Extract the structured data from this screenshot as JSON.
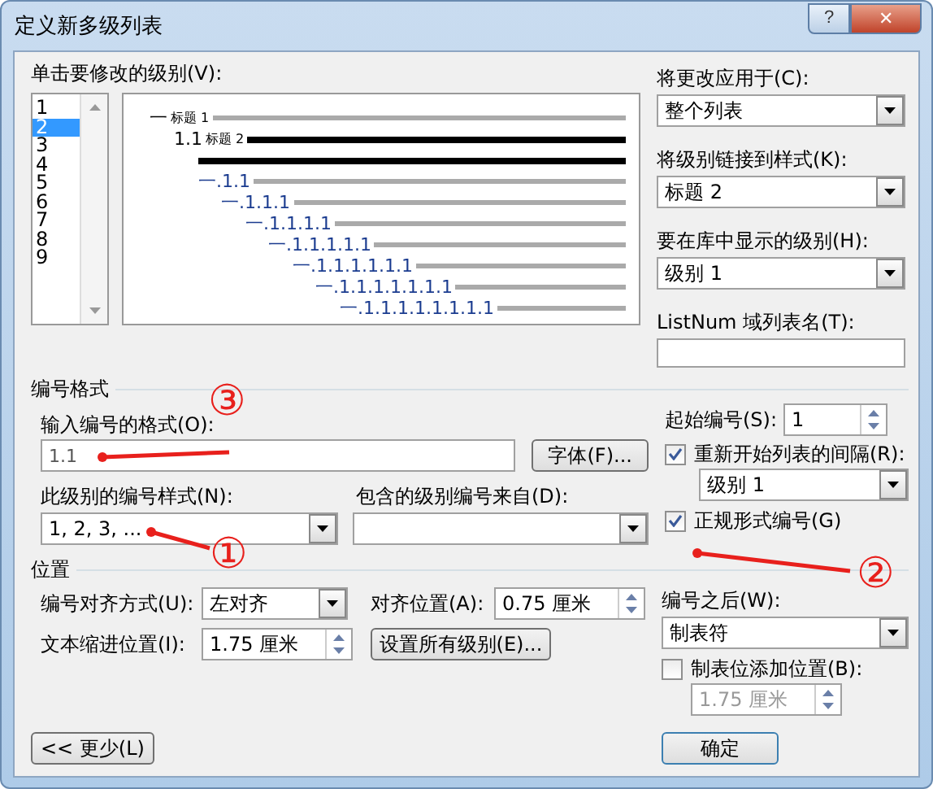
{
  "window": {
    "title": "定义新多级列表",
    "help": "?",
    "close": "✕"
  },
  "level_list": {
    "label": "单击要修改的级别(V):",
    "items": [
      {
        "label": "1",
        "selected": false
      },
      {
        "label": "2",
        "selected": true
      },
      {
        "label": "3",
        "selected": false
      },
      {
        "label": "4",
        "selected": false
      },
      {
        "label": "5",
        "selected": false
      },
      {
        "label": "6",
        "selected": false
      },
      {
        "label": "7",
        "selected": false
      },
      {
        "label": "8",
        "selected": false
      },
      {
        "label": "9",
        "selected": false
      }
    ]
  },
  "preview": [
    {
      "kind": "heading",
      "number": "一",
      "text": "标题 1",
      "selected": false
    },
    {
      "kind": "heading",
      "number": "1.1",
      "text": "标题 2",
      "selected": true
    },
    {
      "kind": "line",
      "selected": true
    },
    {
      "kind": "plain",
      "number": "一.1.1",
      "selected": false
    },
    {
      "kind": "plain",
      "number": "一.1.1.1",
      "selected": false
    },
    {
      "kind": "plain",
      "number": "一.1.1.1.1",
      "selected": false
    },
    {
      "kind": "plain",
      "number": "一.1.1.1.1.1",
      "selected": false
    },
    {
      "kind": "plain",
      "number": "一.1.1.1.1.1.1",
      "selected": false
    },
    {
      "kind": "plain",
      "number": "一.1.1.1.1.1.1.1",
      "selected": false
    },
    {
      "kind": "plain",
      "number": "一.1.1.1.1.1.1.1.1",
      "selected": false
    }
  ],
  "apply_to": {
    "label": "将更改应用于(C):",
    "value": "整个列表"
  },
  "link_style": {
    "label": "将级别链接到样式(K):",
    "value": "标题 2"
  },
  "gallery_level": {
    "label": "要在库中显示的级别(H):",
    "value": "级别 1"
  },
  "listnum": {
    "label": "ListNum 域列表名(T):"
  },
  "number_format": {
    "title": "编号格式",
    "format_label": "输入编号的格式(O):",
    "format_value": "1.1",
    "font_button": "字体(F)...",
    "style_label": "此级别的编号样式(N):",
    "style_value": "1, 2, 3, ...",
    "include_label": "包含的级别编号来自(D):",
    "start_label": "起始编号(S):",
    "start_value": "1",
    "restart": {
      "label": "重新开始列表的间隔(R):",
      "checked": true,
      "value": "级别 1"
    },
    "legal": {
      "label": "正规形式编号(G)",
      "checked": true
    }
  },
  "position": {
    "title": "位置",
    "align_label": "编号对齐方式(U):",
    "align_value": "左对齐",
    "at_label": "对齐位置(A):",
    "at_value": "0.75 厘米",
    "indent_label": "文本缩进位置(I):",
    "indent_value": "1.75 厘米",
    "set_all_button": "设置所有级别(E)...",
    "follow_label": "编号之后(W):",
    "follow_value": "制表符",
    "tab_stop": {
      "label": "制表位添加位置(B):",
      "checked": false,
      "value": "1.75 厘米",
      "disabled": true
    }
  },
  "buttons": {
    "less": "<< 更少(L)",
    "ok": "确定"
  },
  "annotations": [
    {
      "label": "③"
    },
    {
      "label": "①"
    },
    {
      "label": "②"
    }
  ]
}
